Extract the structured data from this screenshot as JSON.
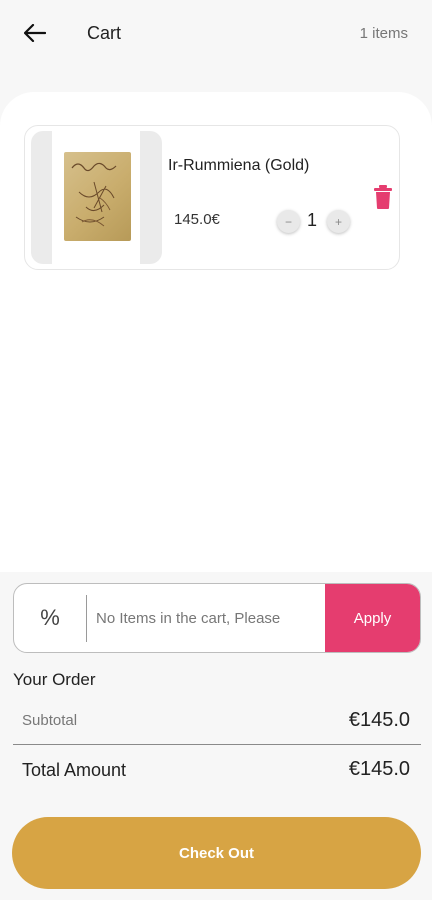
{
  "header": {
    "title": "Cart",
    "item_count": "1 items"
  },
  "cart": {
    "items": [
      {
        "name": "Ir-Rummiena (Gold)",
        "price": "145.0€",
        "quantity": "1",
        "minus_symbol": "−",
        "plus_symbol": "+"
      }
    ]
  },
  "coupon": {
    "icon_symbol": "%",
    "placeholder": "No Items in the cart, Please",
    "apply_label": "Apply"
  },
  "order": {
    "heading": "Your Order",
    "subtotal_label": "Subtotal",
    "subtotal_value": "€145.0",
    "total_label": "Total Amount",
    "total_value": "€145.0"
  },
  "checkout_label": "Check Out",
  "colors": {
    "accent_pink": "#e53d6f",
    "checkout_gold": "#d7a444",
    "trash_pink": "#e53d6f"
  },
  "icons": {
    "back": "arrow-left-icon",
    "delete": "trash-icon"
  }
}
